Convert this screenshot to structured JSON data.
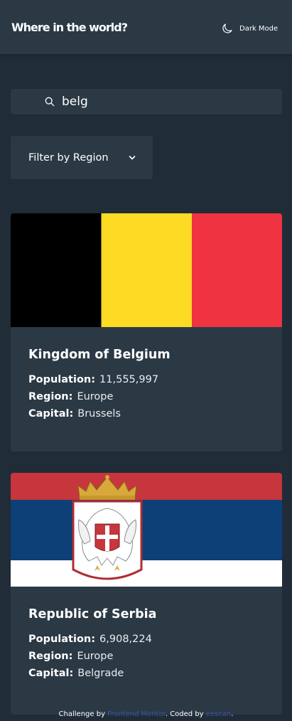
{
  "header": {
    "title": "Where in the world?",
    "dark_mode_label": "Dark Mode",
    "moon_icon": "moon-icon"
  },
  "search": {
    "value": "belg",
    "icon": "search-icon"
  },
  "filter": {
    "label": "Filter by Region",
    "icon": "chevron-down-icon"
  },
  "countries": [
    {
      "name": "Kingdom of Belgium",
      "population_label": "Population:",
      "population": "11,555,997",
      "region_label": "Region:",
      "region": "Europe",
      "capital_label": "Capital:",
      "capital": "Brussels",
      "flag_colors": [
        "#000000",
        "#fdda24",
        "#ef3340"
      ]
    },
    {
      "name": "Republic of Serbia",
      "population_label": "Population:",
      "population": "6,908,224",
      "region_label": "Region:",
      "region": "Europe",
      "capital_label": "Capital:",
      "capital": "Belgrade",
      "flag_colors": [
        "#c6363c",
        "#0c4077",
        "#ffffff"
      ]
    }
  ],
  "footer": {
    "prefix": "Challenge by ",
    "link1": "Frontend Mentor",
    "middle": ". Coded by ",
    "link2": "eescan",
    "suffix": "."
  },
  "colors": {
    "background": "#202c37",
    "surface": "#2b3945",
    "text": "#ffffff",
    "link": "#3e52a3"
  }
}
